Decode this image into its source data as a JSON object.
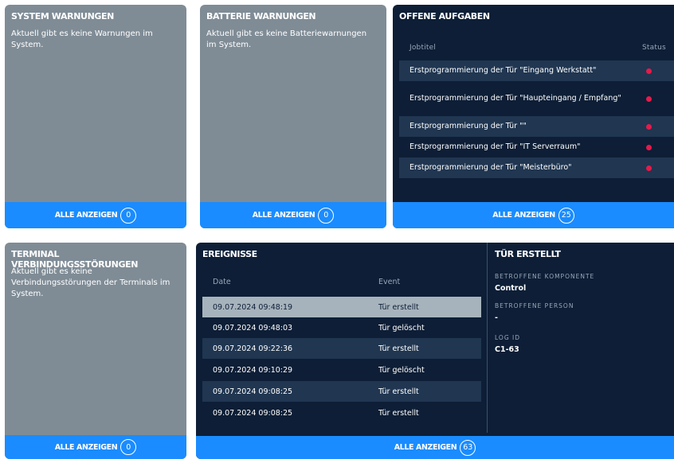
{
  "system_warnings": {
    "title": "SYSTEM WARNUNGEN",
    "text": "Aktuell gibt es keine Warnungen im System.",
    "footer_label": "ALLE ANZEIGEN",
    "count": "0"
  },
  "battery_warnings": {
    "title": "BATTERIE WARNUNGEN",
    "text": "Aktuell gibt es keine Batteriewarnungen im System.",
    "footer_label": "ALLE ANZEIGEN",
    "count": "0"
  },
  "open_tasks": {
    "title": "OFFENE AUFGABEN",
    "col_jobtitle": "Jobtitel",
    "col_status": "Status",
    "rows": [
      {
        "title": "Erstprogrammierung der Tür \"Eingang Werkstatt\"",
        "status": "open"
      },
      {
        "title": "Erstprogrammierung der Tür \"Haupteingang / Empfang\"",
        "status": "open"
      },
      {
        "title": "Erstprogrammierung der Tür \"\"",
        "status": "open"
      },
      {
        "title": "Erstprogrammierung der Tür \"IT Serverraum\"",
        "status": "open"
      },
      {
        "title": "Erstprogrammierung der Tür \"Meisterbüro\"",
        "status": "open"
      }
    ],
    "footer_label": "ALLE ANZEIGEN",
    "count": "25",
    "status_color": "#e8194a"
  },
  "terminal_errors": {
    "title": "TERMINAL VERBINDUNGSSTÖRUNGEN",
    "text": "Aktuell gibt es keine Verbindungsstörungen der Terminals im System.",
    "footer_label": "ALLE ANZEIGEN",
    "count": "0"
  },
  "events": {
    "title": "EREIGNISSE",
    "col_date": "Date",
    "col_event": "Event",
    "rows": [
      {
        "date": "09.07.2024 09:48:19",
        "event": "Tür erstellt"
      },
      {
        "date": "09.07.2024 09:48:03",
        "event": "Tür gelöscht"
      },
      {
        "date": "09.07.2024 09:22:36",
        "event": "Tür erstellt"
      },
      {
        "date": "09.07.2024 09:10:29",
        "event": "Tür gelöscht"
      },
      {
        "date": "09.07.2024 09:08:25",
        "event": "Tür erstellt"
      },
      {
        "date": "09.07.2024 09:08:25",
        "event": "Tür erstellt"
      }
    ],
    "footer_label": "ALLE ANZEIGEN",
    "count": "63",
    "detail": {
      "title": "TÜR ERSTELLT",
      "component_label": "BETROFFENE KOMPONENTE",
      "component_value": "Control",
      "person_label": "BETROFFENE PERSON",
      "person_value": "-",
      "log_label": "LOG ID",
      "log_value": "C1-63"
    }
  },
  "colors": {
    "card_grey": "#7f8c96",
    "card_dark": "#0d1e36",
    "accent_blue": "#1a8cff",
    "row_alt": "#203651",
    "row_selected": "#a7b3bc"
  }
}
